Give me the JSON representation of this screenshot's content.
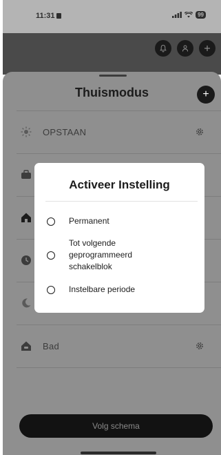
{
  "status_bar": {
    "time": "11:31",
    "battery": "99"
  },
  "sheet": {
    "title": "Thuismodus",
    "rows": [
      {
        "label": "OPSTAAN",
        "icon": "sun-icon"
      },
      {
        "label": "",
        "icon": "briefcase-icon"
      },
      {
        "label": "",
        "icon": "home-icon"
      },
      {
        "label": "",
        "icon": "clock-icon"
      },
      {
        "label": "",
        "icon": "moon-icon"
      },
      {
        "label": "Bad",
        "icon": "bath-home-icon"
      }
    ],
    "follow_button": "Volg schema"
  },
  "modal": {
    "title": "Activeer Instelling",
    "options": [
      {
        "label": "Permanent"
      },
      {
        "label": "Tot volgende geprogrammeerd schakelblok"
      },
      {
        "label": "Instelbare periode"
      }
    ]
  }
}
